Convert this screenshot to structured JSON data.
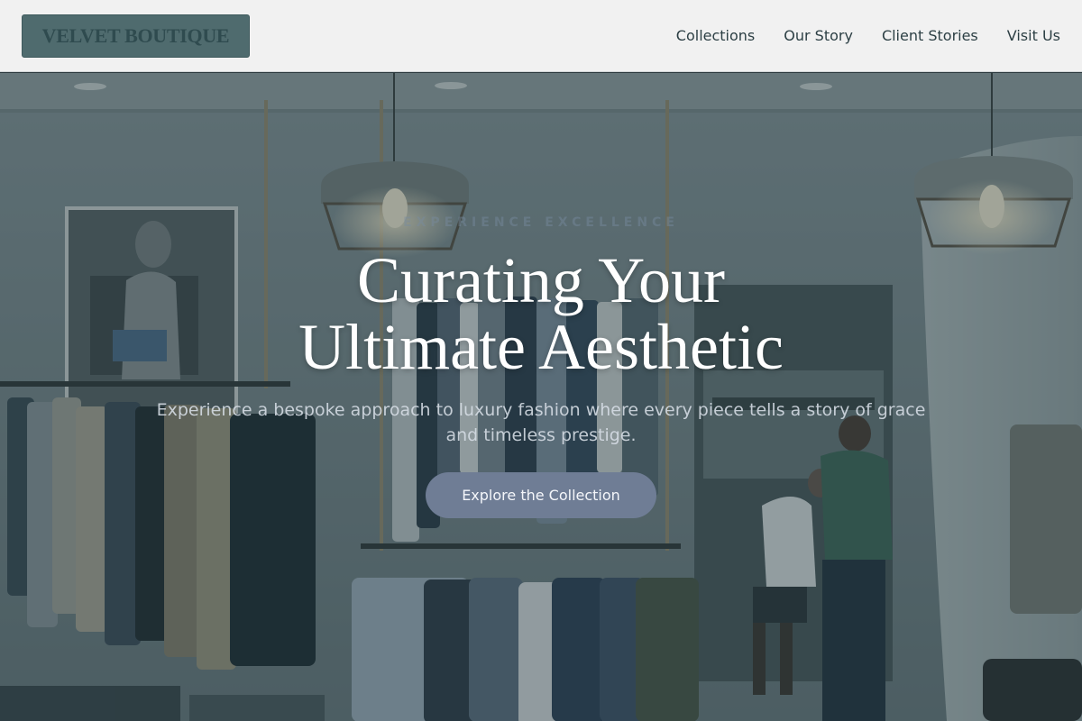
{
  "brand": {
    "logo_text": "VELVET BOUTIQUE"
  },
  "nav": {
    "items": [
      {
        "label": "Collections"
      },
      {
        "label": "Our Story"
      },
      {
        "label": "Client Stories"
      },
      {
        "label": "Visit Us"
      }
    ]
  },
  "hero": {
    "eyebrow": "Experience Excellence",
    "headline_line1": "Curating Your",
    "headline_line2": "Ultimate Aesthetic",
    "subtitle": "Experience a bespoke approach to luxury fashion where every piece tells a story of grace and timeless prestige.",
    "cta_label": "Explore the Collection"
  },
  "colors": {
    "header_bg": "#f1f1f1",
    "logo_bg": "#4f6b6e",
    "logo_text": "#2f4b4f",
    "nav_text": "#2c3f44",
    "cta_bg": "#6f7d95",
    "overlay": "#1e343a"
  }
}
